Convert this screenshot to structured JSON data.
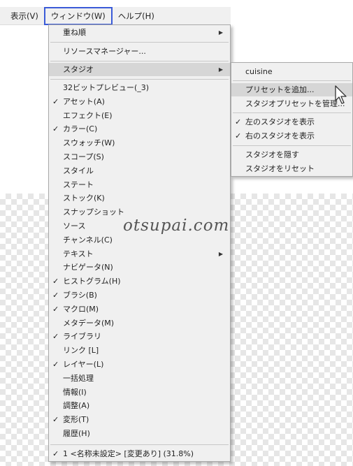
{
  "menubar": {
    "view": "表示(V)",
    "window": "ウィンドウ(W)",
    "help": "ヘルプ(H)"
  },
  "window_menu": {
    "arrange": "重ね順",
    "resource_manager": "リソースマネージャー...",
    "studio": "スタジオ",
    "items": [
      {
        "label": "32ビットプレビュー(_3)",
        "checked": false
      },
      {
        "label": "アセット(A)",
        "checked": true
      },
      {
        "label": "エフェクト(E)",
        "checked": false
      },
      {
        "label": "カラー(C)",
        "checked": true
      },
      {
        "label": "スウォッチ(W)",
        "checked": false
      },
      {
        "label": "スコープ(S)",
        "checked": false
      },
      {
        "label": "スタイル",
        "checked": false
      },
      {
        "label": "ステート",
        "checked": false
      },
      {
        "label": "ストック(K)",
        "checked": false
      },
      {
        "label": "スナップショット",
        "checked": false
      },
      {
        "label": "ソース",
        "checked": false
      },
      {
        "label": "チャンネル(C)",
        "checked": false
      },
      {
        "label": "テキスト",
        "checked": false,
        "submenu": true
      },
      {
        "label": "ナビゲータ(N)",
        "checked": false
      },
      {
        "label": "ヒストグラム(H)",
        "checked": true
      },
      {
        "label": "ブラシ(B)",
        "checked": true
      },
      {
        "label": "マクロ(M)",
        "checked": true
      },
      {
        "label": "メタデータ(M)",
        "checked": false
      },
      {
        "label": "ライブラリ",
        "checked": true
      },
      {
        "label": "リンク [L]",
        "checked": false
      },
      {
        "label": "レイヤー(L)",
        "checked": true
      },
      {
        "label": "一括処理",
        "checked": false
      },
      {
        "label": "情報(I)",
        "checked": false
      },
      {
        "label": "調整(A)",
        "checked": false
      },
      {
        "label": "変形(T)",
        "checked": true
      },
      {
        "label": "履歴(H)",
        "checked": false
      }
    ],
    "document": {
      "label": "1 <名称未設定> [変更あり] (31.8%)",
      "checked": true
    }
  },
  "studio_submenu": {
    "preset_name": "cuisine",
    "add_preset": "プリセットを追加...",
    "manage_presets": "スタジオプリセットを管理...",
    "show_left": "左のスタジオを表示",
    "show_left_checked": true,
    "show_right": "右のスタジオを表示",
    "show_right_checked": true,
    "hide_studio": "スタジオを隠す",
    "reset_studio": "スタジオをリセット"
  },
  "watermark": "otsupai.com",
  "colors": {
    "menu_bg": "#f0f0f0",
    "highlight": "#d6d6d6",
    "active_border": "#3a5bd8"
  },
  "icons": {
    "check": "check-icon",
    "submenu": "submenu-arrow-icon",
    "cursor": "mouse-pointer-icon"
  }
}
